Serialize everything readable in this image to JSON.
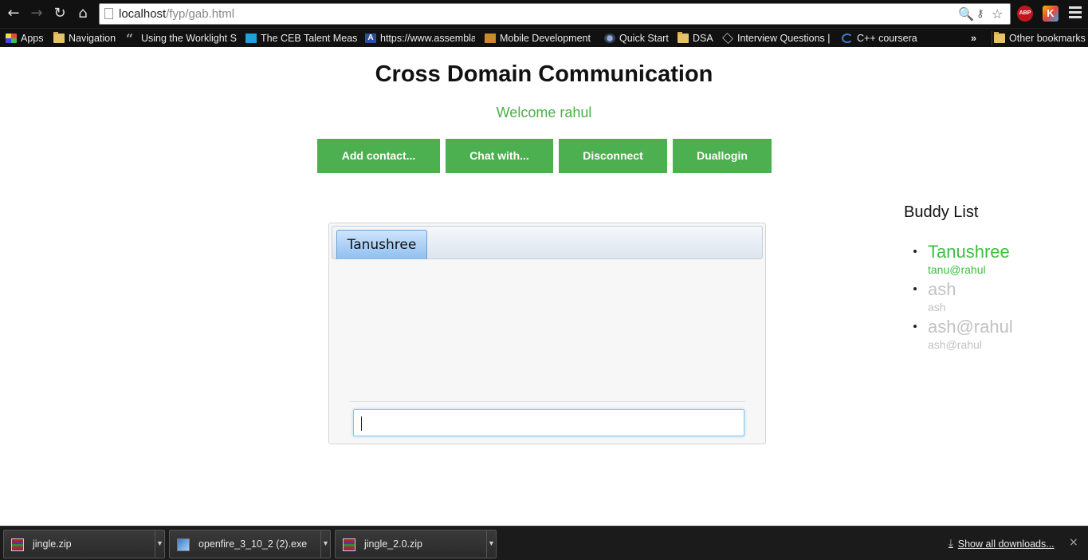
{
  "browser": {
    "url_host": "localhost",
    "url_path": "/fyp/gab.html",
    "icons": {
      "back": "arrow-left-icon",
      "forward": "arrow-right-icon",
      "reload": "reload-icon",
      "home": "home-icon",
      "zoom": "magnifier-icon",
      "key": "key-icon",
      "bookmark": "star-icon",
      "adblock": "abp-icon",
      "extension": "k-icon",
      "menu": "hamburger-icon"
    },
    "adblock_label": "ABP",
    "extension_label": "K",
    "bookmarks": [
      {
        "label": "Apps"
      },
      {
        "label": "Navigation"
      },
      {
        "label": "Using the Worklight S"
      },
      {
        "label": "The CEB Talent Measu"
      },
      {
        "label": "https://www.assembla"
      },
      {
        "label": "Mobile Development"
      },
      {
        "label": "Quick Start"
      },
      {
        "label": "DSA"
      },
      {
        "label": "Interview Questions |"
      },
      {
        "label": "C++ coursera"
      }
    ],
    "bookmarks_overflow": "»",
    "other_bookmarks": "Other bookmarks"
  },
  "page": {
    "title": "Cross Domain Communication",
    "welcome": "Welcome rahul",
    "buttons": {
      "add_contact": "Add contact...",
      "chat_with": "Chat with...",
      "disconnect": "Disconnect",
      "duallogin": "Duallogin"
    },
    "chat": {
      "active_tab": "Tanushree",
      "input_value": ""
    },
    "buddy_list": {
      "title": "Buddy List",
      "buddies": [
        {
          "name": "Tanushree",
          "jid": "tanu@rahul",
          "status": "online"
        },
        {
          "name": "ash",
          "jid": "ash",
          "status": "offline"
        },
        {
          "name": "ash@rahul",
          "jid": "ash@rahul",
          "status": "offline"
        }
      ]
    }
  },
  "downloads": {
    "items": [
      {
        "file": "jingle.zip"
      },
      {
        "file": "openfire_3_10_2 (2).exe"
      },
      {
        "file": "jingle_2.0.zip"
      }
    ],
    "show_all": "Show all downloads...",
    "close": "×"
  },
  "colors": {
    "accent_green": "#4caf50",
    "online_green": "#3fbf3f",
    "offline_gray": "#c2c2c2"
  }
}
